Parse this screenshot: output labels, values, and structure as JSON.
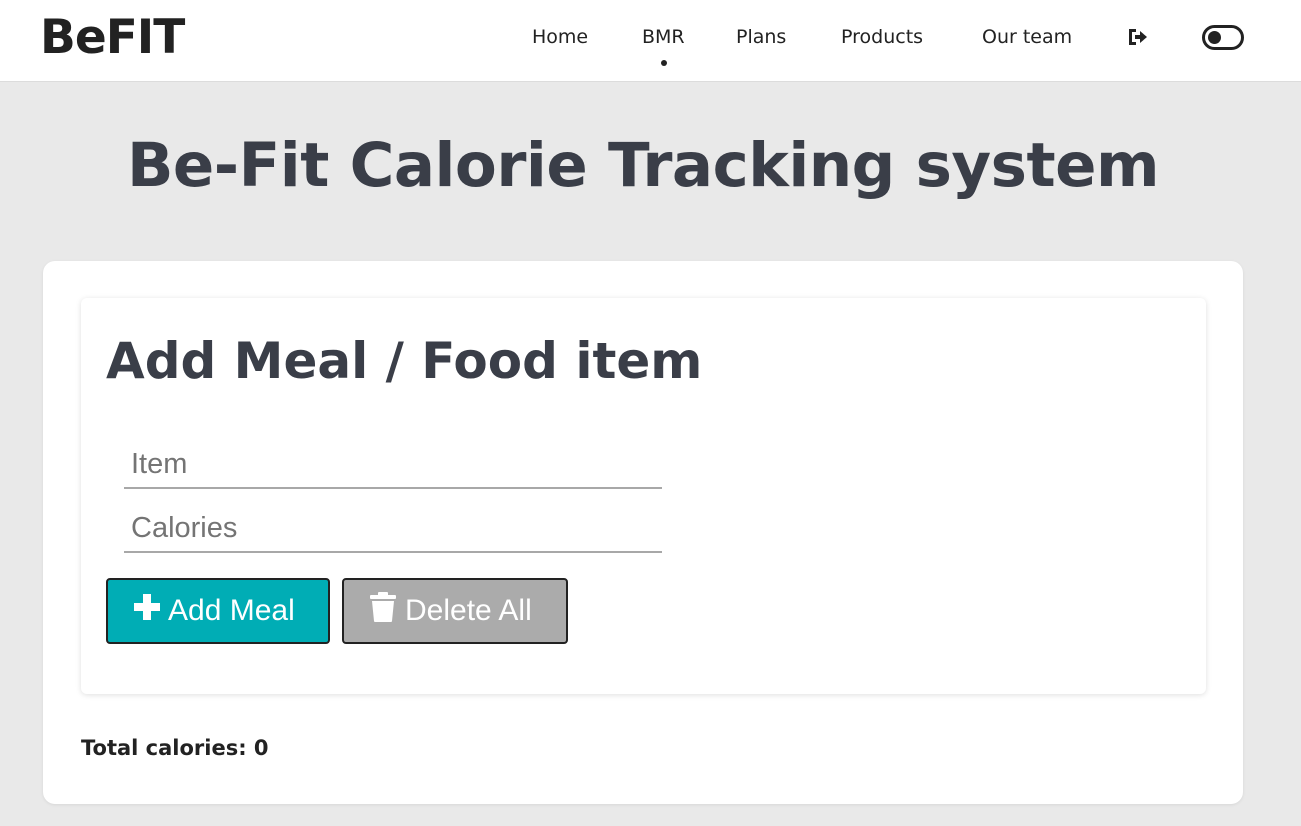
{
  "header": {
    "logo": "BeFIT",
    "nav": [
      {
        "label": "Home"
      },
      {
        "label": "BMR"
      },
      {
        "label": "Plans"
      },
      {
        "label": "Products"
      },
      {
        "label": "Our team"
      }
    ],
    "active_nav": "BMR",
    "icons": [
      "logout-icon",
      "theme-toggle"
    ]
  },
  "main": {
    "title": "Be-Fit Calorie Tracking system",
    "form": {
      "title": "Add Meal / Food item",
      "item_placeholder": "Item",
      "calories_placeholder": "Calories",
      "item_value": "",
      "calories_value": "",
      "add_label": "Add Meal",
      "delete_label": "Delete All"
    },
    "total_calories_text": "Total calories: 0"
  },
  "colors": {
    "background": "#e9e9e9",
    "accent": "#00adb5",
    "delete_button": "#ababab",
    "title_text": "#3a3e48"
  }
}
